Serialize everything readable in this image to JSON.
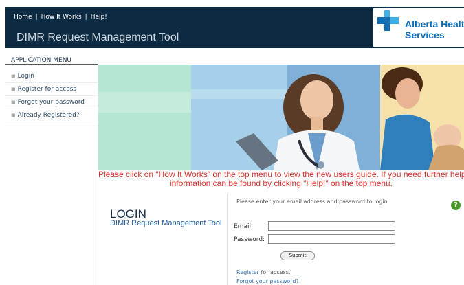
{
  "header": {
    "nav": [
      "Home",
      "How It Works",
      "Help!"
    ],
    "separator": "|",
    "app_title": "DIMR Request Management Tool",
    "logo": {
      "line1": "Alberta Health",
      "line2": "Services"
    }
  },
  "sidebar": {
    "heading": "APPLICATION MENU",
    "items": [
      {
        "label": "Login"
      },
      {
        "label": "Register for access"
      },
      {
        "label": "Forgot your password"
      },
      {
        "label": "Already Registered?"
      }
    ]
  },
  "notice": {
    "line1": "Please click on \"How It Works\" on the top menu to view the new users guide. If you need further help, our contact",
    "line2": "information can be found by clicking \"Help!\" on the top menu."
  },
  "login": {
    "title": "LOGIN",
    "subtitle": "DIMR Request Management Tool",
    "prompt": "Please enter your email address and password to login.",
    "help_glyph": "?",
    "email_label": "Email:",
    "email_value": "",
    "password_label": "Password:",
    "password_value": "",
    "submit_label": "Submit",
    "register_link": "Register",
    "register_suffix": " for access.",
    "forgot_link": "Forgot your password?"
  },
  "colors": {
    "header_bg": "#0c2a42",
    "brand_blue": "#0a6fb8",
    "brand_sky": "#3ab0e6",
    "notice_red": "#e0312b",
    "help_green": "#4a9a2b"
  }
}
